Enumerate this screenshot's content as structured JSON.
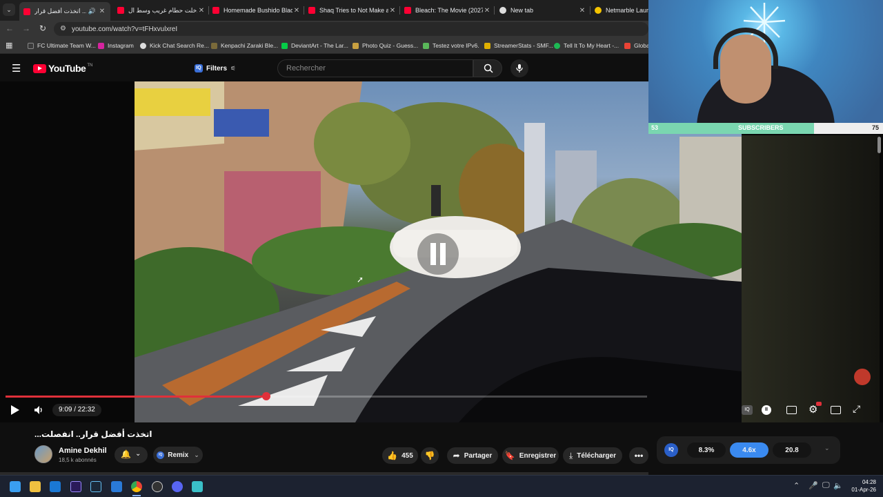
{
  "browser": {
    "tabs": [
      {
        "title": "انقد.. اتخذت أفضل قرار",
        "active": true
      },
      {
        "title": "دخلت حطام غريب وسط ال",
        "active": false
      },
      {
        "title": "Homemade Bushido Blac",
        "active": false
      },
      {
        "title": "Shaq Tries to Not Make a",
        "active": false
      },
      {
        "title": "Bleach: The Movie (2027)",
        "active": false
      },
      {
        "title": "New tab",
        "active": false
      },
      {
        "title": "Netmarble Launc",
        "active": false
      }
    ],
    "url": "youtube.com/watch?v=tFHxvulxreI",
    "bookmarks": [
      "FC Ultimate Team W...",
      "Instagram",
      "Kick Chat Search Re...",
      "Kenpachi Zaraki Ble...",
      "DeviantArt - The Lar...",
      "Photo Quiz - Guess...",
      "Testez votre IPv6.",
      "StreamerStats - SMF...",
      "Tell It To My Heart -...",
      "Globa"
    ]
  },
  "youtube": {
    "logo_text": "YouTube",
    "logo_sup": "TN",
    "filters_label": "Filters",
    "search_placeholder": "Rechercher"
  },
  "player": {
    "time": "9:09 / 22:32",
    "progress_fraction": 0.406,
    "accent": "#e0303a"
  },
  "video": {
    "title": "...اتخذت أفضل قرار.. انفصلت",
    "channel": "Amine Dekhil",
    "subscribers": "18,5 k abonnés",
    "remix_label": "Remix",
    "likes": "455",
    "share_label": "Partager",
    "save_label": "Enregistrer",
    "download_label": "Télécharger"
  },
  "stats": {
    "percent": "8.3%",
    "multiplier": "4.6x",
    "score": "20.8"
  },
  "webcam_overlay": {
    "sub_current": "53",
    "sub_label": "SUBSCRIBERS",
    "sub_goal": "75",
    "sub_fraction": 0.706
  },
  "taskbar": {
    "time": "04:28",
    "date": "01-Apr-26"
  }
}
